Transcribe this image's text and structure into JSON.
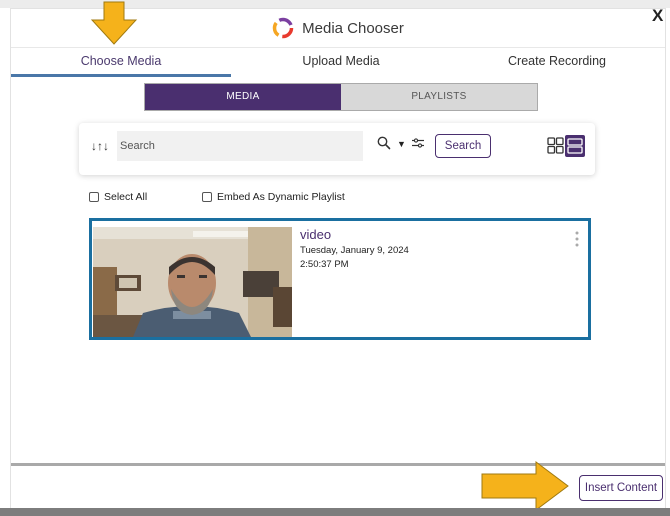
{
  "window": {
    "title": "Media Chooser",
    "close_label": "X"
  },
  "tabs": [
    {
      "label": "Choose Media",
      "active": true
    },
    {
      "label": "Upload Media",
      "active": false
    },
    {
      "label": "Create Recording",
      "active": false
    }
  ],
  "segment": {
    "options": [
      "MEDIA",
      "PLAYLISTS"
    ],
    "selected": "MEDIA"
  },
  "search": {
    "placeholder": "Search",
    "value": "",
    "button_label": "Search"
  },
  "options": {
    "select_all_label": "Select All",
    "embed_playlist_label": "Embed As Dynamic Playlist"
  },
  "media_items": [
    {
      "title": "video",
      "date": "Tuesday, January 9, 2024",
      "time": "2:50:37 PM"
    }
  ],
  "footer": {
    "insert_label": "Insert Content"
  },
  "colors": {
    "accent": "#4a2f6f",
    "selection_border": "#1a6fa0",
    "tab_underline": "#4a77a8",
    "arrow": "#f5b21b"
  },
  "icons": [
    "sort-icon",
    "search-icon",
    "chevron-down-icon",
    "filter-icon",
    "grid-view-icon",
    "list-view-icon",
    "more-options-icon",
    "media-chooser-logo-icon"
  ]
}
